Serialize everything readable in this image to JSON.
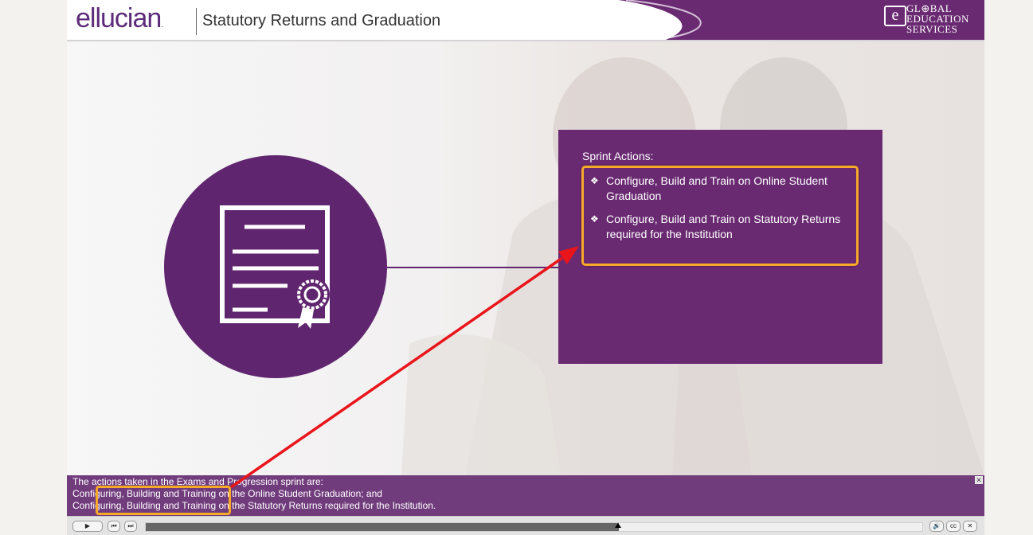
{
  "header": {
    "logo_text": "ellucian",
    "logo_mark": ".",
    "title": "Statutory Returns and Graduation",
    "partner_logo_letter": "e",
    "partner_logo_lines": [
      "GL⊕BAL",
      "EDUCATION",
      "SERVICES"
    ]
  },
  "stage": {
    "info_box": {
      "title": "Sprint Actions:",
      "bullet_glyph": "❖",
      "items": [
        "Configure, Build and Train on Online Student Graduation",
        "Configure, Build and Train on Statutory Returns required for the Institution"
      ]
    }
  },
  "caption": {
    "lines": [
      "The actions taken in the Exams and Progression sprint are:",
      "Configuring, Building and Training on the Online Student Graduation; and",
      "Configuring, Building and Training on the Statutory Returns required for the Institution."
    ],
    "close_glyph": "✕"
  },
  "player": {
    "play_glyph": "▶",
    "rewind_glyph": "⏮",
    "forward_glyph": "⏭",
    "volume_glyph": "🔊",
    "cc_label": "cc",
    "close_glyph": "✕",
    "progress_fraction": 0.608
  },
  "colors": {
    "brand_purple": "#60256f",
    "box_purple": "#6a2a72",
    "caption_purple": "#713c7c",
    "highlight_orange": "#f7a928",
    "arrow_red": "#e8151b"
  },
  "icons": [
    "certificate-icon",
    "play-icon",
    "rewind-icon",
    "forward-icon",
    "volume-icon",
    "cc-icon",
    "close-icon"
  ]
}
